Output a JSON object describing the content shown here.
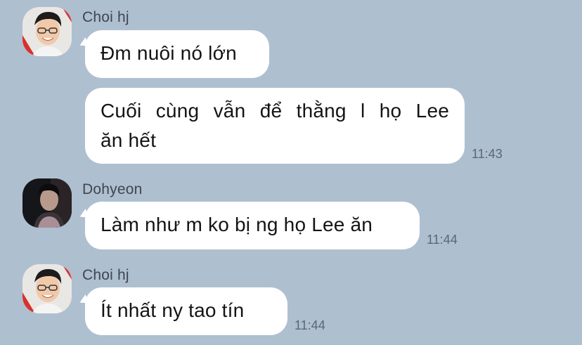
{
  "colors": {
    "background": "#aebfd0",
    "bubble": "#ffffff",
    "sender_text": "#3f4650",
    "time_text": "#5d6673",
    "message_text": "#141414"
  },
  "messages": [
    {
      "sender": "Choi hj",
      "avatar": "avatar-choi-hj",
      "lines": [
        "Đm nuôi nó lớn"
      ],
      "time": ""
    },
    {
      "sender": "",
      "avatar": "",
      "lines": [
        "Cuối cùng vẫn để thằng l họ Lee",
        "ăn hết"
      ],
      "time": "11:43"
    },
    {
      "sender": "Dohyeon",
      "avatar": "avatar-dohyeon",
      "lines": [
        "Làm như m ko bị ng họ Lee ăn"
      ],
      "time": "11:44"
    },
    {
      "sender": "Choi hj",
      "avatar": "avatar-choi-hj",
      "lines": [
        "Ít nhất ny tao tín"
      ],
      "time": "11:44"
    }
  ]
}
